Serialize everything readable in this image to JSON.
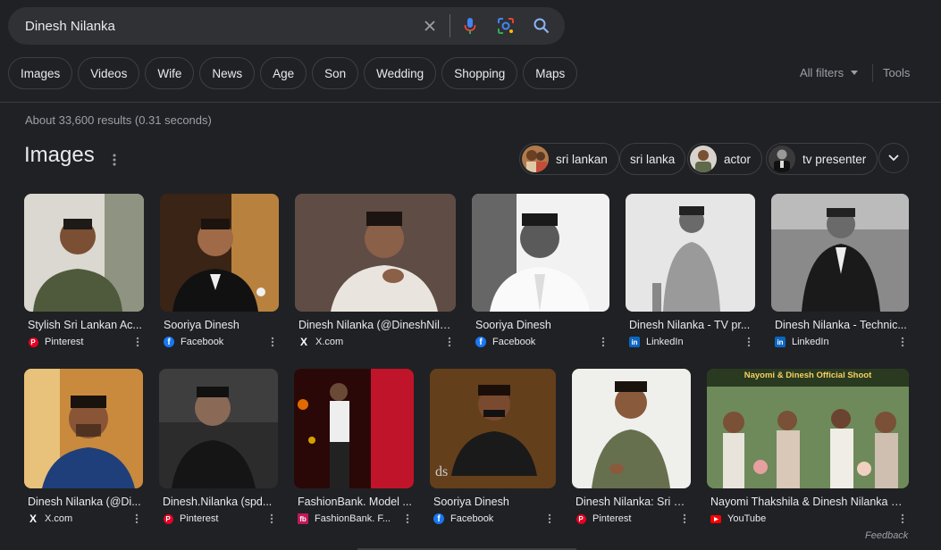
{
  "search": {
    "query": "Dinesh Nilanka"
  },
  "chips": [
    "Images",
    "Videos",
    "Wife",
    "News",
    "Age",
    "Son",
    "Wedding",
    "Shopping",
    "Maps"
  ],
  "filters": {
    "all_filters": "All filters",
    "tools": "Tools"
  },
  "stats": "About 33,600 results (0.31 seconds)",
  "images_section": {
    "heading": "Images",
    "related": [
      {
        "label": "sri lankan",
        "has_thumb": true
      },
      {
        "label": "sri lanka",
        "has_thumb": false
      },
      {
        "label": "actor",
        "has_thumb": true
      },
      {
        "label": "tv presenter",
        "has_thumb": true
      }
    ]
  },
  "results": [
    {
      "caption": "Stylish Sri Lankan Ac...",
      "source": "Pinterest",
      "icon": "pinterest-icon"
    },
    {
      "caption": "Sooriya Dinesh",
      "source": "Facebook",
      "icon": "facebook-icon"
    },
    {
      "caption": "Dinesh Nilanka (@DineshNila...",
      "source": "X.com",
      "icon": "x-icon"
    },
    {
      "caption": "Sooriya Dinesh",
      "source": "Facebook",
      "icon": "facebook-icon"
    },
    {
      "caption": "Dinesh Nilanka - TV pr...",
      "source": "LinkedIn",
      "icon": "linkedin-icon"
    },
    {
      "caption": "Dinesh Nilanka - Technic...",
      "source": "LinkedIn",
      "icon": "linkedin-icon"
    },
    {
      "caption": "Dinesh Nilanka (@Di...",
      "source": "X.com",
      "icon": "x-icon"
    },
    {
      "caption": "Dinesh.Nilanka (spd...",
      "source": "Pinterest",
      "icon": "pinterest-icon"
    },
    {
      "caption": "FashionBank. Model ...",
      "source": "FashionBank. F...",
      "icon": "fashionbank-icon"
    },
    {
      "caption": "Sooriya Dinesh",
      "source": "Facebook",
      "icon": "facebook-icon"
    },
    {
      "caption": "Dinesh Nilanka: Sri L...",
      "source": "Pinterest",
      "icon": "pinterest-icon"
    },
    {
      "caption": "Nayomi Thakshila & Dinesh Nilanka O...",
      "source": "YouTube",
      "icon": "youtube-icon",
      "overlay_text": "Nayomi & Dinesh Official Shoot"
    }
  ],
  "feedback": "Feedback",
  "colors": {
    "background": "#202124",
    "surface": "#303134",
    "border": "#3c4043",
    "text": "#e8eaed",
    "muted": "#9aa0a6",
    "link_blue": "#8ab4f8"
  }
}
